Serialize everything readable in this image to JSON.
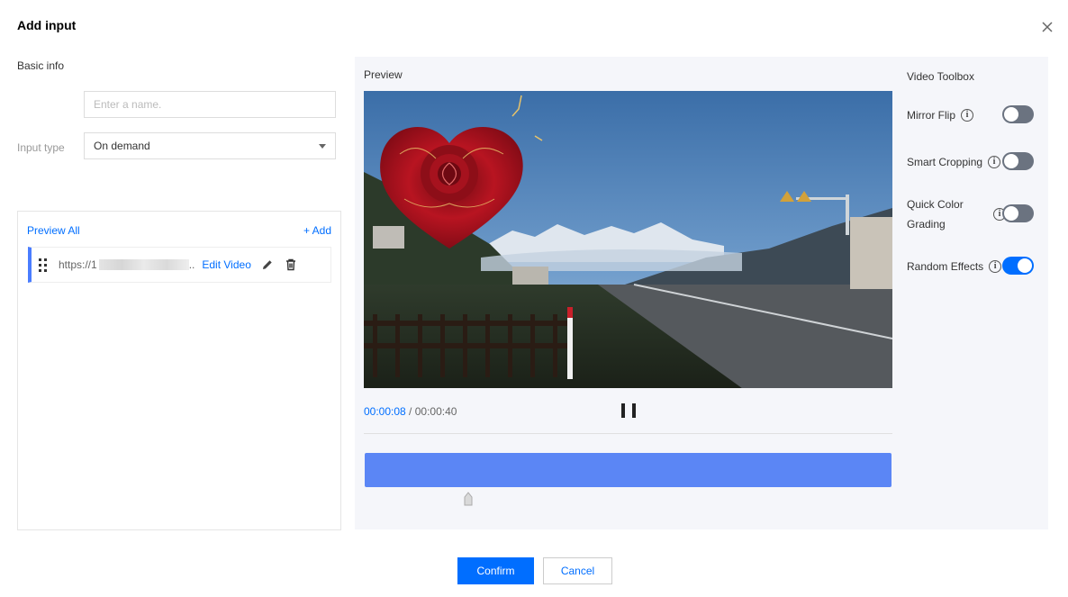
{
  "dialog": {
    "title": "Add input",
    "close_icon": "close-icon"
  },
  "basic_info": {
    "section_label": "Basic info",
    "name_placeholder": "Enter a name.",
    "input_type_label": "Input type",
    "input_type_value": "On demand"
  },
  "input_list": {
    "preview_all": "Preview All",
    "add": "+ Add",
    "items": [
      {
        "url_prefix": "https://1",
        "url_suffix": "..",
        "edit_label": "Edit Video",
        "edit_icon": "pencil-icon",
        "delete_icon": "trash-icon"
      }
    ]
  },
  "preview": {
    "title": "Preview",
    "current_time": "00:00:08",
    "separator": " / ",
    "total_time": "00:00:40"
  },
  "toolbox": {
    "title": "Video Toolbox",
    "tools": [
      {
        "label": "Mirror Flip",
        "enabled": false
      },
      {
        "label": "Smart Cropping",
        "enabled": false
      },
      {
        "label": "Quick Color Grading",
        "enabled": false
      },
      {
        "label": "Random Effects",
        "enabled": true
      }
    ]
  },
  "footer": {
    "confirm_label": "Confirm",
    "cancel_label": "Cancel"
  },
  "colors": {
    "accent": "#006eff",
    "timeline": "#5b86f5",
    "toggle_off": "#6b7380"
  }
}
